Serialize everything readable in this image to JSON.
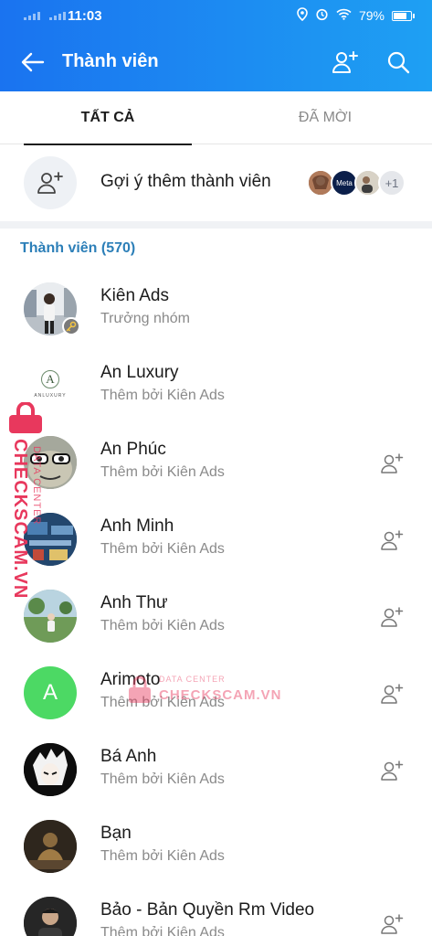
{
  "status": {
    "time": "11:03",
    "battery": "79%"
  },
  "header": {
    "title": "Thành viên"
  },
  "tabs": [
    {
      "label": "TẤT CẢ",
      "active": true
    },
    {
      "label": "ĐÃ MỜI",
      "active": false
    }
  ],
  "suggest": {
    "label": "Gợi ý thêm thành viên",
    "more_count": "+1",
    "avatar_text": "Meta"
  },
  "section": {
    "title": "Thành viên (570)"
  },
  "members": [
    {
      "name": "Kiên Ads",
      "subtitle": "Trưởng nhóm",
      "avatar_letter": ""
    },
    {
      "name": "An Luxury",
      "subtitle": "Thêm bởi Kiên Ads",
      "avatar_letter": "A",
      "avatar_caption": "ANLUXURY"
    },
    {
      "name": "An Phúc",
      "subtitle": "Thêm bởi Kiên Ads",
      "avatar_letter": ""
    },
    {
      "name": "Anh Minh",
      "subtitle": "Thêm bởi Kiên Ads",
      "avatar_letter": ""
    },
    {
      "name": "Anh Thư",
      "subtitle": "Thêm bởi Kiên Ads",
      "avatar_letter": ""
    },
    {
      "name": "Arimoto",
      "subtitle": "Thêm bởi Kiên Ads",
      "avatar_letter": "A"
    },
    {
      "name": "Bá Anh",
      "subtitle": "Thêm bởi Kiên Ads",
      "avatar_letter": ""
    },
    {
      "name": "Bạn",
      "subtitle": "Thêm bởi Kiên Ads",
      "avatar_letter": ""
    },
    {
      "name": "Bảo - Bản Quyền Rm Video",
      "subtitle": "Thêm bởi Kiên Ads",
      "avatar_letter": ""
    }
  ],
  "watermark": {
    "vertical_main": "CHECKSCAM.VN",
    "vertical_sub": "DATA CENTER",
    "center_top": "DATA CENTER",
    "center_main": "CHECKSCAM.VN"
  },
  "colors": {
    "accent": "#1a73f0",
    "section": "#2c7fb8",
    "watermark": "#e8385d",
    "arimoto_avatar": "#4cd964"
  }
}
